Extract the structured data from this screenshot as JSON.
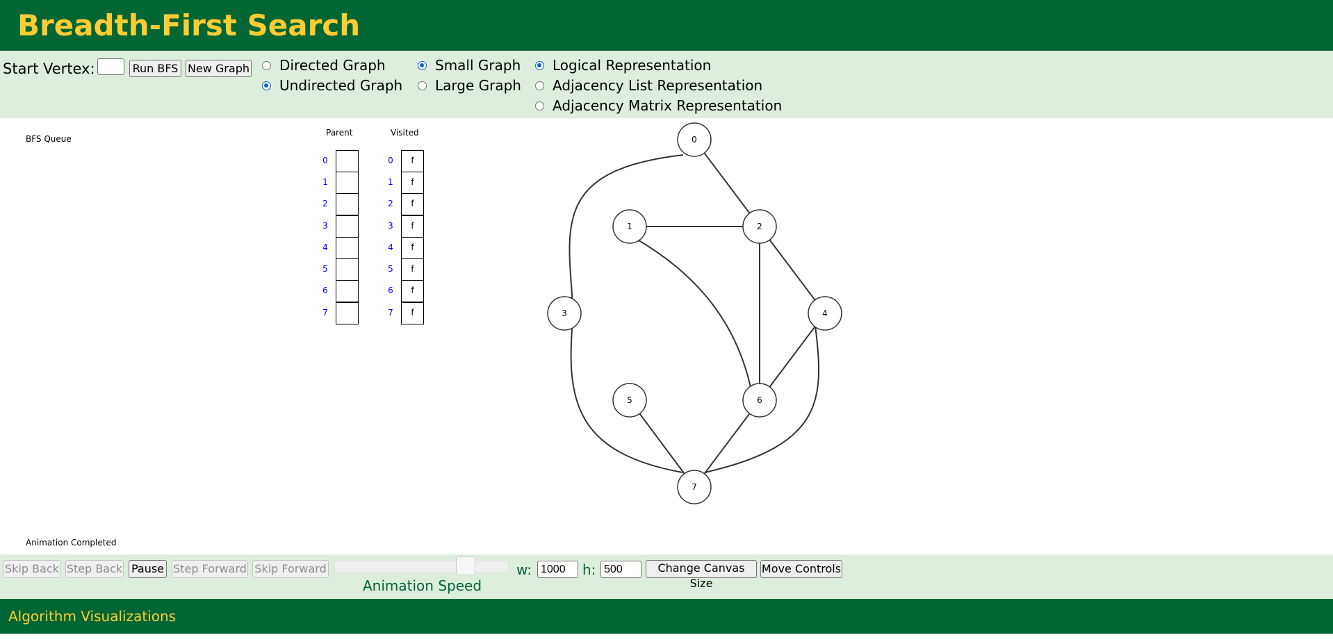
{
  "header": {
    "title": "Breadth-First Search"
  },
  "controls": {
    "start_vertex_label": "Start Vertex:",
    "start_vertex_value": "",
    "run_button": "Run BFS",
    "new_graph_button": "New Graph",
    "graph_direction": [
      {
        "label": "Directed Graph",
        "selected": false
      },
      {
        "label": "Undirected Graph",
        "selected": true
      }
    ],
    "graph_size": [
      {
        "label": "Small Graph",
        "selected": true
      },
      {
        "label": "Large Graph",
        "selected": false
      }
    ],
    "representation": [
      {
        "label": "Logical Representation",
        "selected": true
      },
      {
        "label": "Adjacency List Representation",
        "selected": false
      },
      {
        "label": "Adjacency Matrix Representation",
        "selected": false
      }
    ]
  },
  "canvas": {
    "queue_label": "BFS Queue",
    "status_label": "Animation Completed",
    "parent_header": "Parent",
    "visited_header": "Visited",
    "indices": [
      "0",
      "1",
      "2",
      "3",
      "4",
      "5",
      "6",
      "7"
    ],
    "parent_values": [
      "",
      "",
      "",
      "",
      "",
      "",
      "",
      ""
    ],
    "visited_values": [
      "f",
      "f",
      "f",
      "f",
      "f",
      "f",
      "f",
      "f"
    ],
    "graph": {
      "vertices": [
        "0",
        "1",
        "2",
        "3",
        "4",
        "5",
        "6",
        "7"
      ],
      "edges": [
        [
          "0",
          "2"
        ],
        [
          "0",
          "3"
        ],
        [
          "1",
          "2"
        ],
        [
          "1",
          "6"
        ],
        [
          "2",
          "4"
        ],
        [
          "2",
          "6"
        ],
        [
          "3",
          "7"
        ],
        [
          "4",
          "6"
        ],
        [
          "4",
          "7"
        ],
        [
          "5",
          "7"
        ],
        [
          "6",
          "7"
        ]
      ]
    }
  },
  "animation_controls": {
    "skip_back": "Skip Back",
    "step_back": "Step Back",
    "pause": "Pause",
    "step_forward": "Step Forward",
    "skip_forward": "Skip Forward",
    "speed_label": "Animation Speed",
    "width_label": "w:",
    "width_value": "1000",
    "height_label": "h:",
    "height_value": "500",
    "change_size_button": "Change Canvas Size",
    "move_controls_button": "Move Controls"
  },
  "footer": {
    "text": "Algorithm Visualizations"
  }
}
